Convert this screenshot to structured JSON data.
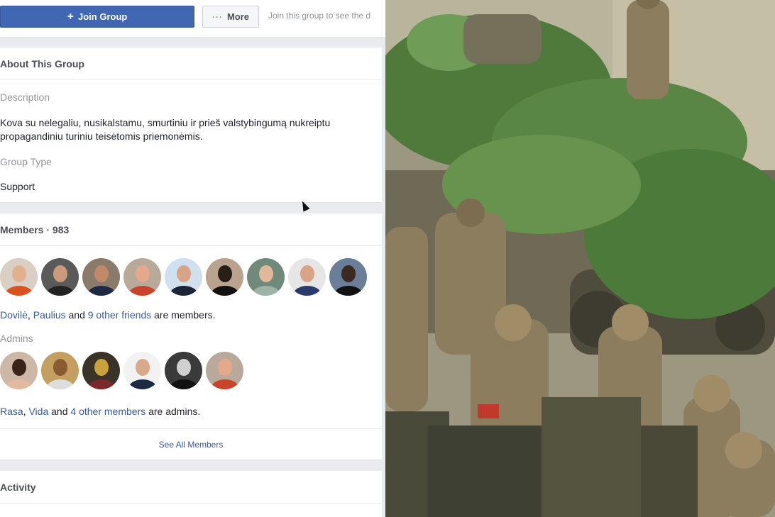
{
  "header": {
    "join_label": "Join Group",
    "more_label": "More",
    "join_hint": "Join this group to see the d"
  },
  "about": {
    "title": "About This Group",
    "description_label": "Description",
    "description": "Kova su nelegaliu, nusikalstamu, smurtiniu ir prieš valstybingumą nukreiptu propagandiniu turiniu teisėtomis priemonėmis.",
    "type_label": "Group Type",
    "type": "Support"
  },
  "members": {
    "title": "Members · 983",
    "friends_line": {
      "name1": "Dovilė",
      "sep": ", ",
      "name2": "Paulius",
      "and": " and ",
      "others": "9 other friends",
      "suffix": " are members."
    },
    "admins_label": "Admins",
    "admins_line": {
      "name1": "Rasa",
      "sep": ", ",
      "name2": "Vida",
      "and": " and ",
      "others": "4 other members",
      "suffix": " are admins."
    },
    "see_all": "See All Members"
  },
  "activity": {
    "title": "Activity"
  },
  "colors": {
    "brand": "#4267b2",
    "link": "#385898",
    "page_bg": "#e9ebee"
  }
}
